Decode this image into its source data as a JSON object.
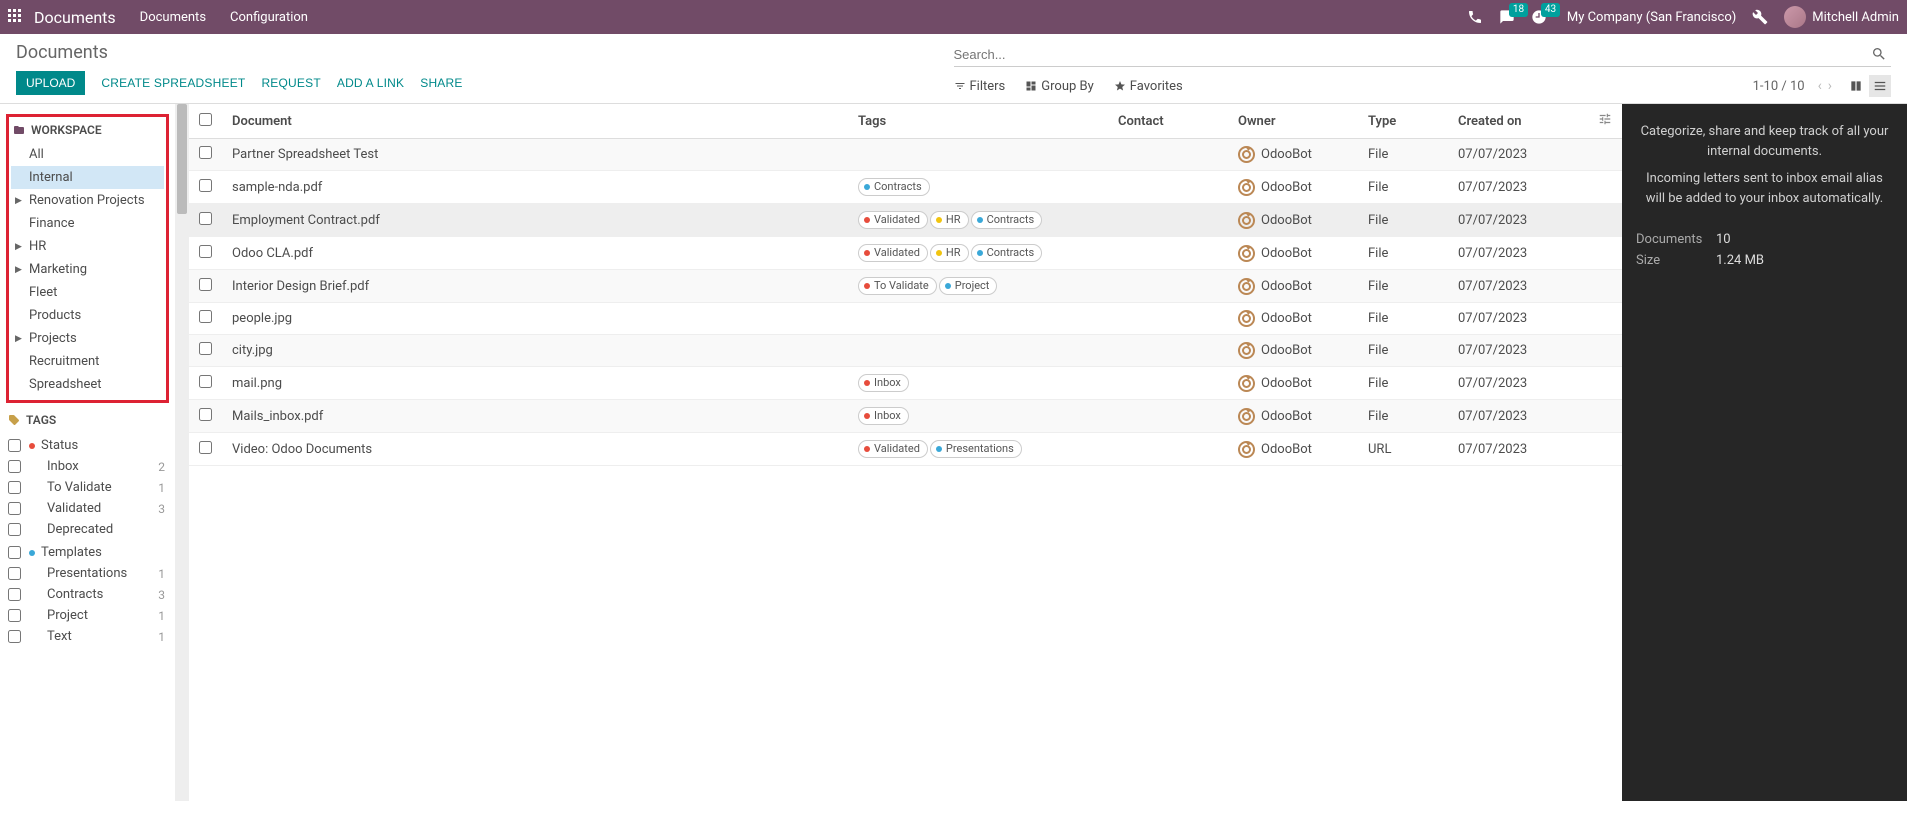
{
  "topbar": {
    "brand": "Documents",
    "menu": [
      "Documents",
      "Configuration"
    ],
    "msg_badge": "18",
    "clock_badge": "43",
    "company": "My Company (San Francisco)",
    "user": "Mitchell Admin"
  },
  "header": {
    "breadcrumb": "Documents",
    "upload": "UPLOAD",
    "create_spreadsheet": "CREATE SPREADSHEET",
    "request": "REQUEST",
    "add_link": "ADD A LINK",
    "share": "SHARE",
    "search_placeholder": "Search...",
    "filters": "Filters",
    "group_by": "Group By",
    "favorites": "Favorites",
    "pager": "1-10 / 10"
  },
  "sidebar": {
    "workspace_label": "WORKSPACE",
    "workspaces": [
      {
        "label": "All",
        "caret": false,
        "active": false
      },
      {
        "label": "Internal",
        "caret": false,
        "active": true
      },
      {
        "label": "Renovation Projects",
        "caret": true,
        "active": false
      },
      {
        "label": "Finance",
        "caret": false,
        "active": false
      },
      {
        "label": "HR",
        "caret": true,
        "active": false
      },
      {
        "label": "Marketing",
        "caret": true,
        "active": false
      },
      {
        "label": "Fleet",
        "caret": false,
        "active": false
      },
      {
        "label": "Products",
        "caret": false,
        "active": false
      },
      {
        "label": "Projects",
        "caret": true,
        "active": false
      },
      {
        "label": "Recruitment",
        "caret": false,
        "active": false
      },
      {
        "label": "Spreadsheet",
        "caret": false,
        "active": false
      }
    ],
    "tags_label": "TAGS",
    "tag_groups": [
      {
        "header": "Status",
        "color": "#e74c3c",
        "items": [
          {
            "label": "Inbox",
            "count": "2"
          },
          {
            "label": "To Validate",
            "count": "1"
          },
          {
            "label": "Validated",
            "count": "3"
          },
          {
            "label": "Deprecated",
            "count": ""
          }
        ]
      },
      {
        "header": "Templates",
        "color": "#3aa8d8",
        "items": [
          {
            "label": "Presentations",
            "count": "1"
          },
          {
            "label": "Contracts",
            "count": "3"
          },
          {
            "label": "Project",
            "count": "1"
          },
          {
            "label": "Text",
            "count": "1"
          }
        ]
      }
    ]
  },
  "table": {
    "headers": {
      "document": "Document",
      "tags": "Tags",
      "contact": "Contact",
      "owner": "Owner",
      "type": "Type",
      "created": "Created on"
    },
    "rows": [
      {
        "doc": "Partner Spreadsheet Test",
        "tags": [],
        "owner": "OdooBot",
        "type": "File",
        "created": "07/07/2023",
        "hl": false
      },
      {
        "doc": "sample-nda.pdf",
        "tags": [
          {
            "label": "Contracts",
            "color": "#3aa8d8"
          }
        ],
        "owner": "OdooBot",
        "type": "File",
        "created": "07/07/2023",
        "hl": false
      },
      {
        "doc": "Employment Contract.pdf",
        "tags": [
          {
            "label": "Validated",
            "color": "#e74c3c"
          },
          {
            "label": "HR",
            "color": "#f1c40f"
          },
          {
            "label": "Contracts",
            "color": "#3aa8d8"
          }
        ],
        "owner": "OdooBot",
        "type": "File",
        "created": "07/07/2023",
        "hl": true
      },
      {
        "doc": "Odoo CLA.pdf",
        "tags": [
          {
            "label": "Validated",
            "color": "#e74c3c"
          },
          {
            "label": "HR",
            "color": "#f1c40f"
          },
          {
            "label": "Contracts",
            "color": "#3aa8d8"
          }
        ],
        "owner": "OdooBot",
        "type": "File",
        "created": "07/07/2023",
        "hl": false
      },
      {
        "doc": "Interior Design Brief.pdf",
        "tags": [
          {
            "label": "To Validate",
            "color": "#e74c3c"
          },
          {
            "label": "Project",
            "color": "#3aa8d8"
          }
        ],
        "owner": "OdooBot",
        "type": "File",
        "created": "07/07/2023",
        "hl": false
      },
      {
        "doc": "people.jpg",
        "tags": [],
        "owner": "OdooBot",
        "type": "File",
        "created": "07/07/2023",
        "hl": false
      },
      {
        "doc": "city.jpg",
        "tags": [],
        "owner": "OdooBot",
        "type": "File",
        "created": "07/07/2023",
        "hl": false
      },
      {
        "doc": "mail.png",
        "tags": [
          {
            "label": "Inbox",
            "color": "#e74c3c"
          }
        ],
        "owner": "OdooBot",
        "type": "File",
        "created": "07/07/2023",
        "hl": false
      },
      {
        "doc": "Mails_inbox.pdf",
        "tags": [
          {
            "label": "Inbox",
            "color": "#e74c3c"
          }
        ],
        "owner": "OdooBot",
        "type": "File",
        "created": "07/07/2023",
        "hl": false
      },
      {
        "doc": "Video: Odoo Documents",
        "tags": [
          {
            "label": "Validated",
            "color": "#e74c3c"
          },
          {
            "label": "Presentations",
            "color": "#3aa8d8"
          }
        ],
        "owner": "OdooBot",
        "type": "URL",
        "created": "07/07/2023",
        "hl": false
      }
    ]
  },
  "right_panel": {
    "desc1": "Categorize, share and keep track of all your internal documents.",
    "desc2": "Incoming letters sent to inbox email alias will be added to your inbox automatically.",
    "stat_docs_label": "Documents",
    "stat_docs_val": "10",
    "stat_size_label": "Size",
    "stat_size_val": "1.24 MB"
  }
}
